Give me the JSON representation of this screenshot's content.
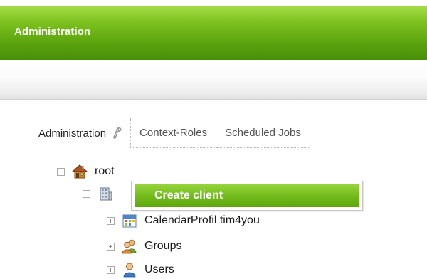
{
  "header": {
    "title": "Administration"
  },
  "tabs": [
    {
      "label": "Administration",
      "active": true
    },
    {
      "label": "Context-Roles",
      "active": false
    },
    {
      "label": "Scheduled Jobs",
      "active": false
    }
  ],
  "tree": {
    "root": {
      "label": "root",
      "icon": "house-icon",
      "expanded": true
    },
    "client": {
      "label": "",
      "icon": "building-icon",
      "expanded": true
    },
    "children": [
      {
        "label": "CalendarProfil tim4you",
        "icon": "calendar-icon",
        "expanded": false
      },
      {
        "label": "Groups",
        "icon": "group-icon",
        "expanded": false
      },
      {
        "label": "Users",
        "icon": "user-icon",
        "expanded": false
      }
    ]
  },
  "context_menu": {
    "items": [
      {
        "label": "Create client",
        "highlighted": true
      }
    ]
  },
  "colors": {
    "accent_green": "#6cb418",
    "header_text": "#ffffff"
  }
}
